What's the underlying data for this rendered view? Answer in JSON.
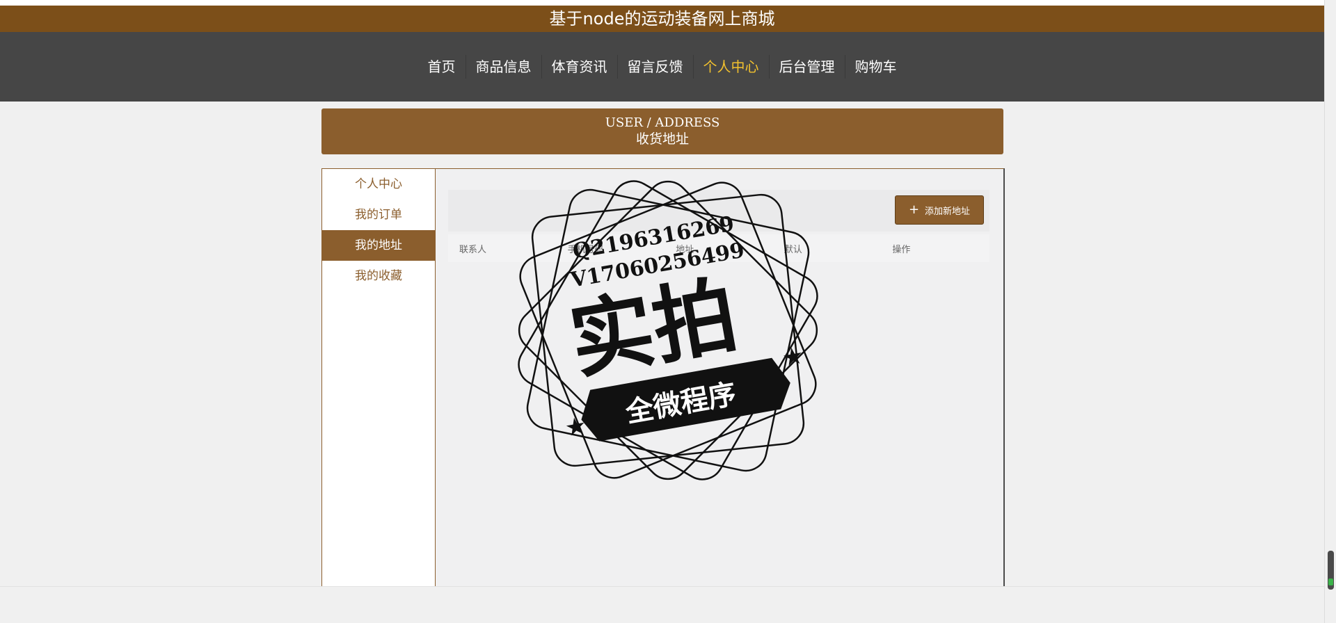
{
  "site": {
    "title": "基于node的运动装备网上商城"
  },
  "nav": {
    "items": [
      {
        "label": "首页",
        "name": "nav-home"
      },
      {
        "label": "商品信息",
        "name": "nav-products"
      },
      {
        "label": "体育资讯",
        "name": "nav-news"
      },
      {
        "label": "留言反馈",
        "name": "nav-feedback"
      },
      {
        "label": "个人中心",
        "name": "nav-profile",
        "active": true
      },
      {
        "label": "后台管理",
        "name": "nav-admin"
      },
      {
        "label": "购物车",
        "name": "nav-cart"
      }
    ],
    "active_color": "#f2c12e"
  },
  "banner": {
    "en": "USER / ADDRESS",
    "cn": "收货地址"
  },
  "sidemenu": {
    "items": [
      {
        "label": "个人中心",
        "name": "side-profile"
      },
      {
        "label": "我的订单",
        "name": "side-orders"
      },
      {
        "label": "我的地址",
        "name": "side-address",
        "active": true
      },
      {
        "label": "我的收藏",
        "name": "side-favorites"
      }
    ]
  },
  "address": {
    "add_button": "添加新地址",
    "columns": [
      "联系人",
      "手机号码",
      "地址",
      "默认",
      "操作"
    ]
  },
  "watermark": {
    "line1": "Q2196316269",
    "line2": "V17060256499",
    "big": "实拍",
    "ribbon": "全微程序"
  },
  "colors": {
    "brand_brown": "#7c4f19",
    "nav_bg": "#464646",
    "accent_brown": "#8b5e2d"
  }
}
